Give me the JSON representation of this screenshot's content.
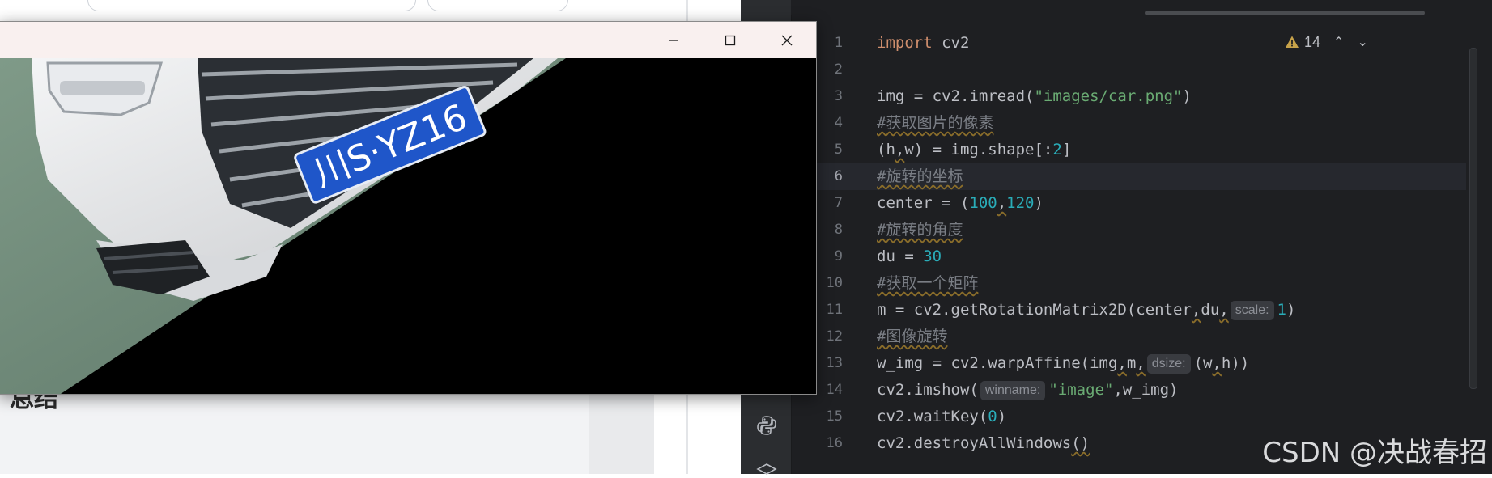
{
  "ide": {
    "warning_count": "14",
    "active_line": 6,
    "lines": [
      {
        "n": "1",
        "parts": [
          {
            "t": "import ",
            "c": "kw"
          },
          {
            "t": "cv2"
          }
        ]
      },
      {
        "n": "2",
        "parts": []
      },
      {
        "n": "3",
        "parts": [
          {
            "t": "img = cv2.imread("
          },
          {
            "t": "\"images/car.png\"",
            "c": "str"
          },
          {
            "t": ")"
          }
        ]
      },
      {
        "n": "4",
        "parts": [
          {
            "t": "#获取图片的像素",
            "c": "cmt"
          }
        ]
      },
      {
        "n": "5",
        "parts": [
          {
            "t": "(h"
          },
          {
            "t": ",",
            "c": "comma"
          },
          {
            "t": "w) = img.shape[:"
          },
          {
            "t": "2",
            "c": "num"
          },
          {
            "t": "]"
          }
        ]
      },
      {
        "n": "6",
        "parts": [
          {
            "t": "#旋转的坐标",
            "c": "cmt"
          }
        ]
      },
      {
        "n": "7",
        "parts": [
          {
            "t": "center = ("
          },
          {
            "t": "100",
            "c": "num"
          },
          {
            "t": ",",
            "c": "comma"
          },
          {
            "t": "120",
            "c": "num"
          },
          {
            "t": ")"
          }
        ]
      },
      {
        "n": "8",
        "parts": [
          {
            "t": "#旋转的角度",
            "c": "cmt"
          }
        ]
      },
      {
        "n": "9",
        "parts": [
          {
            "t": "du = "
          },
          {
            "t": "30",
            "c": "num"
          }
        ]
      },
      {
        "n": "10",
        "parts": [
          {
            "t": "#获取一个矩阵",
            "c": "cmt"
          }
        ]
      },
      {
        "n": "11",
        "parts": [
          {
            "t": "m = cv2.getRotationMatrix2D(center"
          },
          {
            "t": ",",
            "c": "comma"
          },
          {
            "t": "du"
          },
          {
            "t": ",",
            "c": "comma"
          },
          {
            "t": "scale:",
            "c": "hint"
          },
          {
            "t": "1",
            "c": "num"
          },
          {
            "t": ")"
          }
        ]
      },
      {
        "n": "12",
        "parts": [
          {
            "t": "#图像旋转",
            "c": "cmt"
          }
        ]
      },
      {
        "n": "13",
        "parts": [
          {
            "t": "w_img = cv2.warpAffine(img"
          },
          {
            "t": ",",
            "c": "comma"
          },
          {
            "t": "m"
          },
          {
            "t": ",",
            "c": "comma"
          },
          {
            "t": "dsize:",
            "c": "hint"
          },
          {
            "t": "(w"
          },
          {
            "t": ",",
            "c": "comma"
          },
          {
            "t": "h))"
          }
        ]
      },
      {
        "n": "14",
        "parts": [
          {
            "t": "cv2.imshow("
          },
          {
            "t": "winname:",
            "c": "hint"
          },
          {
            "t": "\"image\"",
            "c": "str"
          },
          {
            "t": ",w_img)"
          }
        ]
      },
      {
        "n": "15",
        "parts": [
          {
            "t": "cv2.waitKey("
          },
          {
            "t": "0",
            "c": "num"
          },
          {
            "t": ")"
          }
        ]
      },
      {
        "n": "16",
        "parts": [
          {
            "t": "cv2.destroyAllWindows"
          },
          {
            "t": "()",
            "c": "comma"
          }
        ]
      }
    ]
  },
  "image_window": {
    "plate_text": "川S·YZ16",
    "colors": {
      "title_bar": "#f9f0ef",
      "plate": "#1f56c9",
      "car_body": "#e8e9ea",
      "ground": "#6f8a78"
    }
  },
  "background_page": {
    "heading": "总结"
  },
  "watermark": "CSDN @决战春招"
}
